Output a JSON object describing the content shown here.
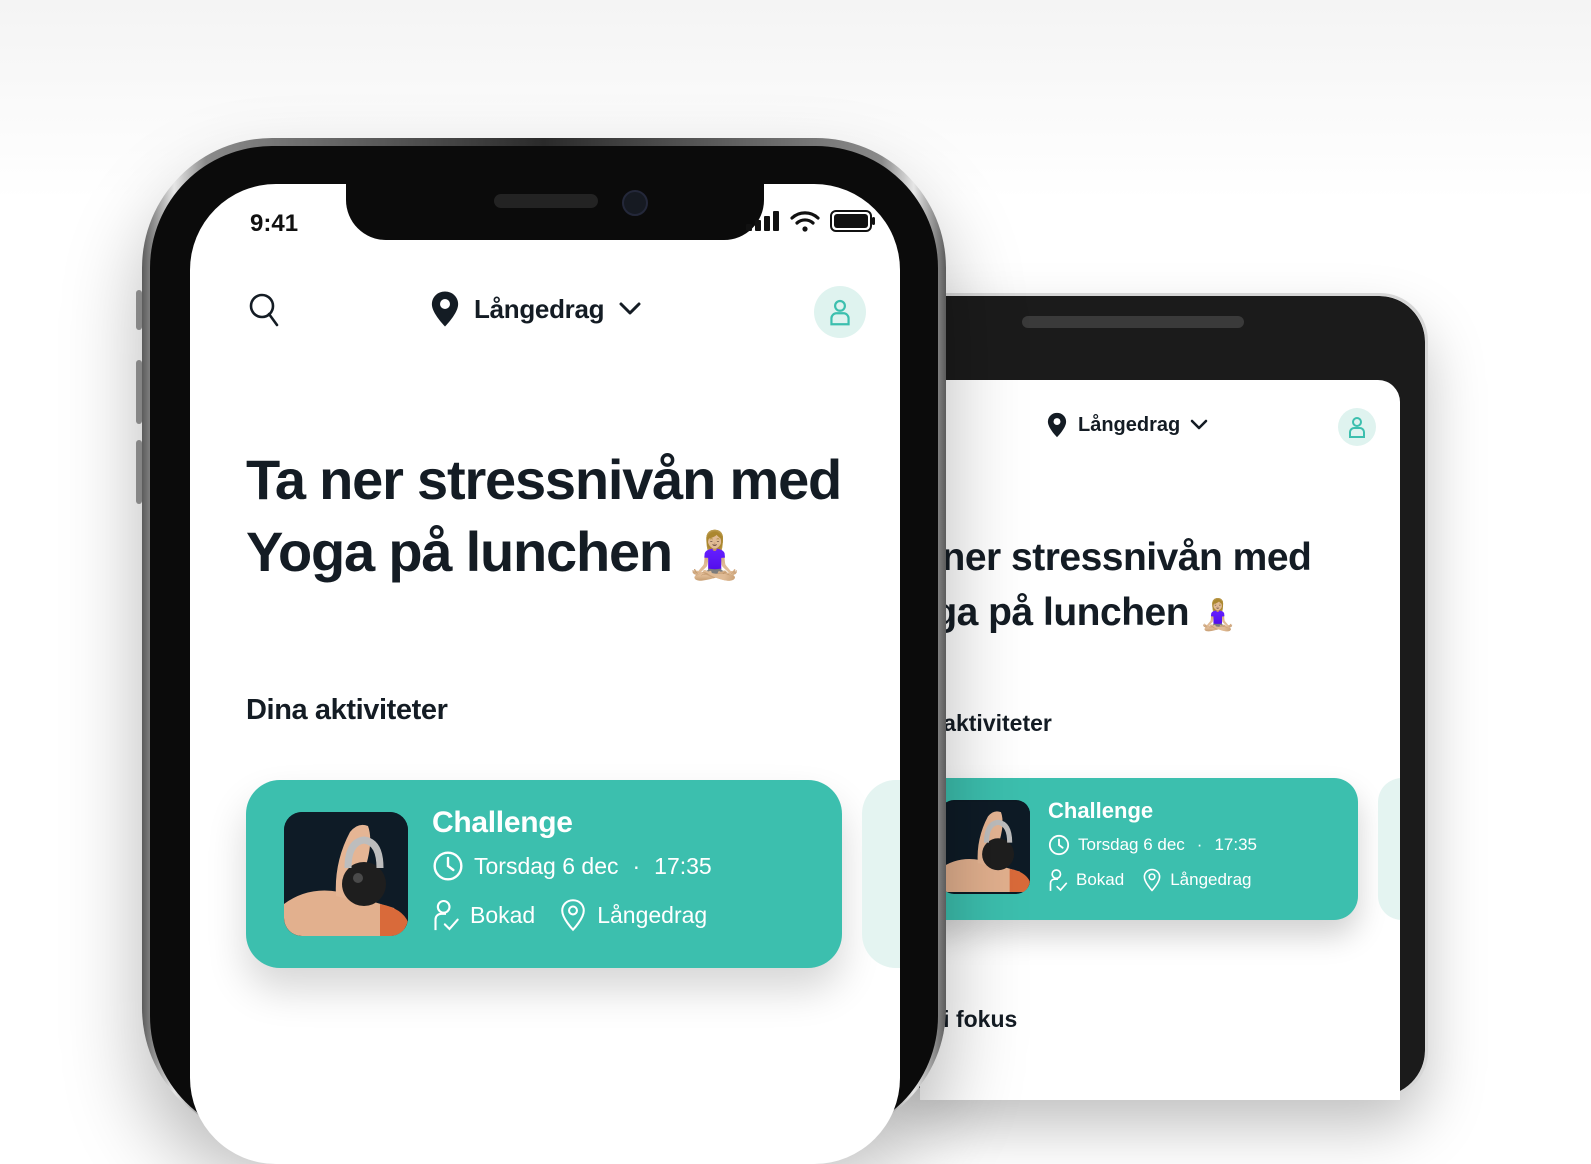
{
  "status_bar": {
    "time": "9:41"
  },
  "header": {
    "location": "Långedrag"
  },
  "hero": {
    "line1": "Ta ner stressnivån med",
    "line2": "Yoga på lunchen",
    "emoji": "🧘🏼‍♀️"
  },
  "sections": {
    "activities": "Dina aktiviteter",
    "focus": "s i fokus"
  },
  "activity": {
    "title": "Challenge",
    "day": "Torsdag 6 dec",
    "separator": "·",
    "time": "17:35",
    "status": "Bokad",
    "place": "Långedrag"
  },
  "back_device": {
    "location": "Långedrag",
    "hero_line1": "a ner stressnivån med",
    "hero_line2": "oga på lunchen",
    "section_activities": "a aktiviteter"
  },
  "colors": {
    "accent": "#3cbfae",
    "accent_light": "#dff3ef",
    "text": "#141c24"
  },
  "icons": [
    "search-icon",
    "location-pin-icon",
    "chevron-down-icon",
    "profile-icon",
    "clock-icon",
    "booked-icon",
    "map-pin-icon",
    "signal-icon",
    "wifi-icon",
    "battery-icon"
  ]
}
